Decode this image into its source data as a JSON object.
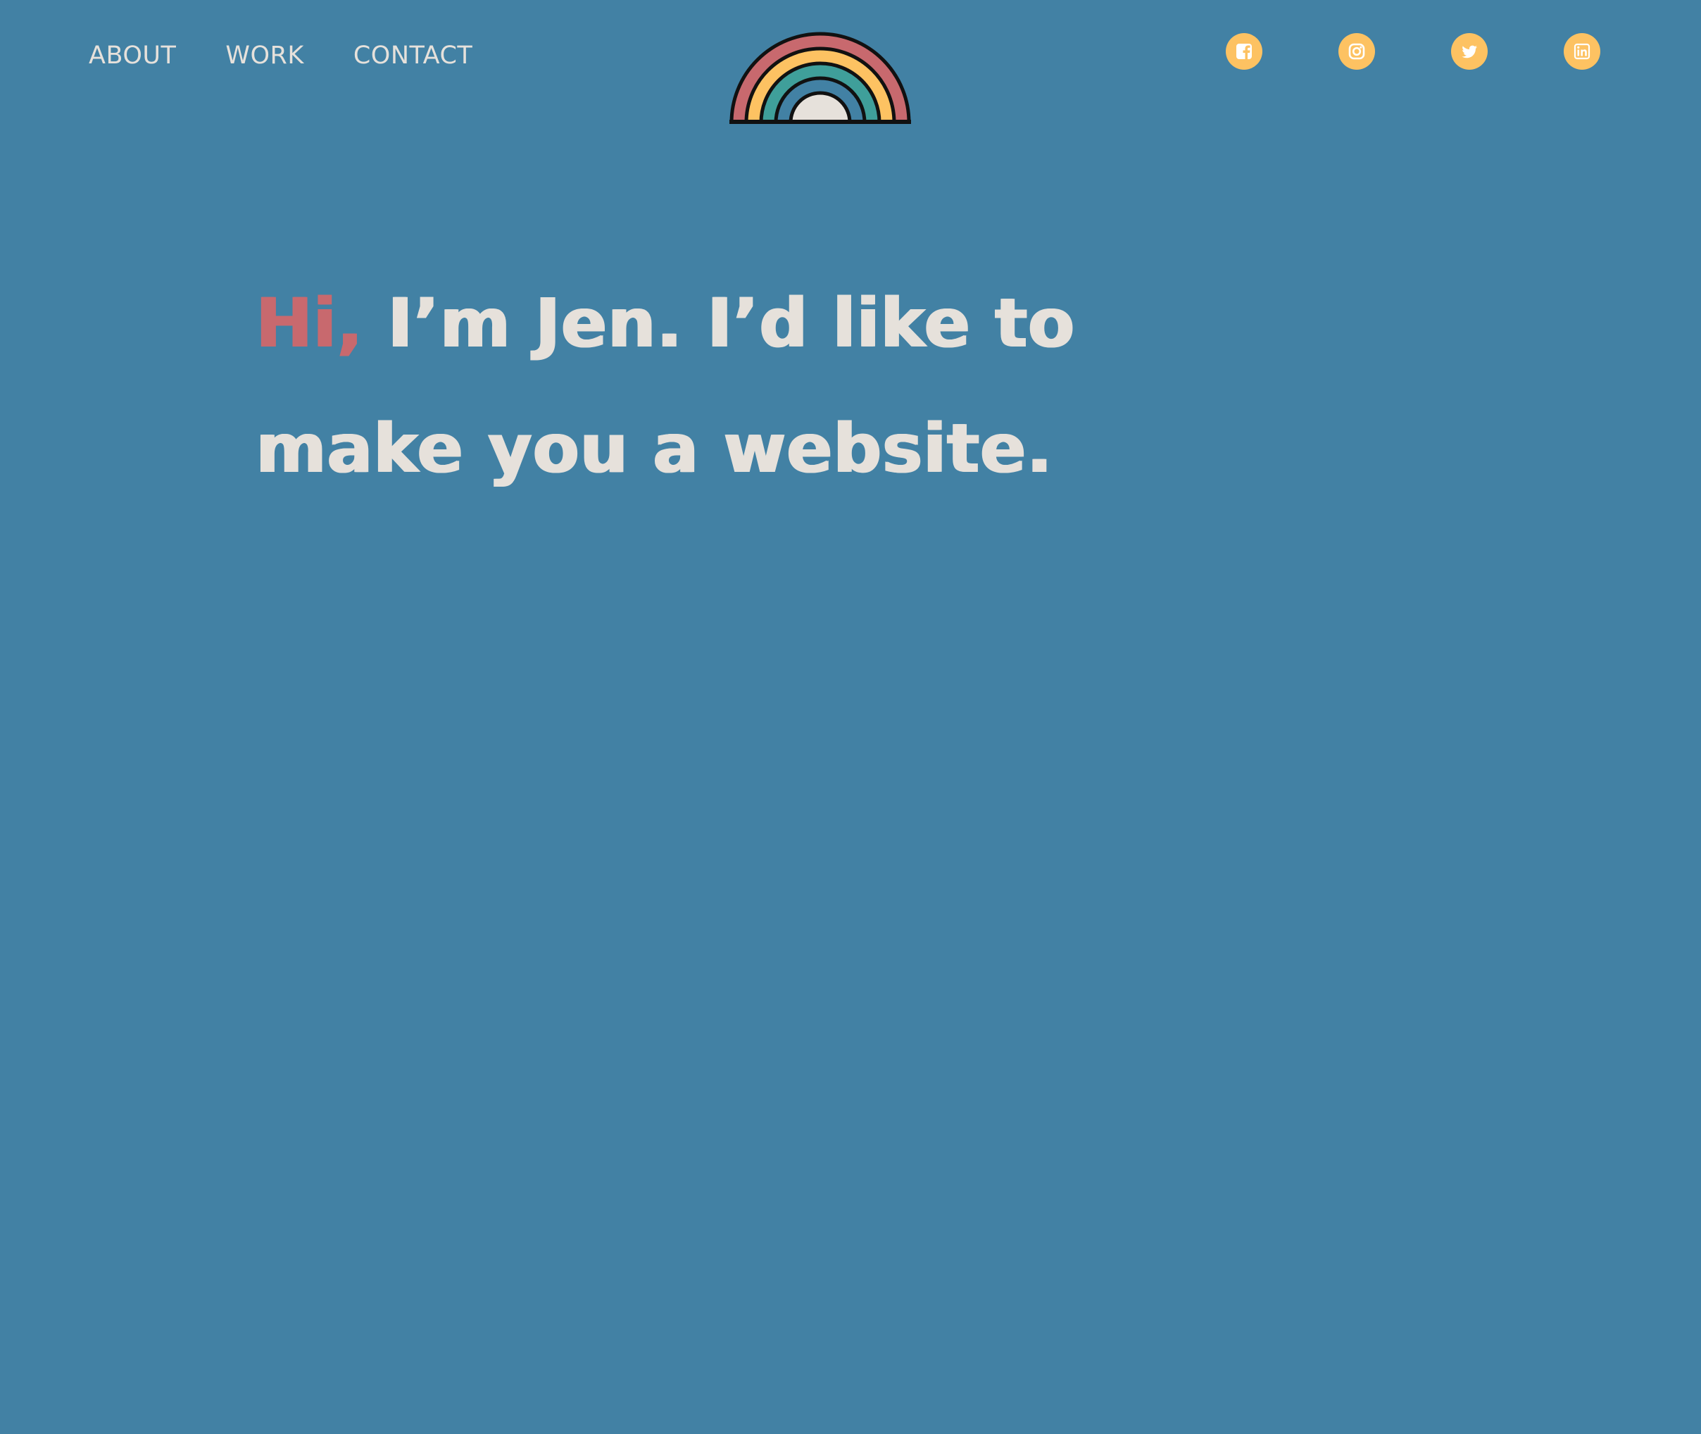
{
  "nav": {
    "links": [
      {
        "label": "ABOUT"
      },
      {
        "label": "WORK"
      },
      {
        "label": "CONTACT"
      }
    ]
  },
  "logo": {
    "icon": "rainbow-icon",
    "colors": [
      "#c8696e",
      "#fdc262",
      "#3f9f9a",
      "#4281a4",
      "#e6e1db"
    ]
  },
  "socials": [
    {
      "icon": "facebook-icon"
    },
    {
      "icon": "instagram-icon"
    },
    {
      "icon": "twitter-icon"
    },
    {
      "icon": "linkedin-icon"
    }
  ],
  "hero": {
    "greeting": "Hi,",
    "text": " I’m Jen. I’d like to make you a website."
  },
  "colors": {
    "background": "#4281a4",
    "text": "#e6e1db",
    "accent": "#c8696e",
    "icon_bg": "#fdc262"
  }
}
